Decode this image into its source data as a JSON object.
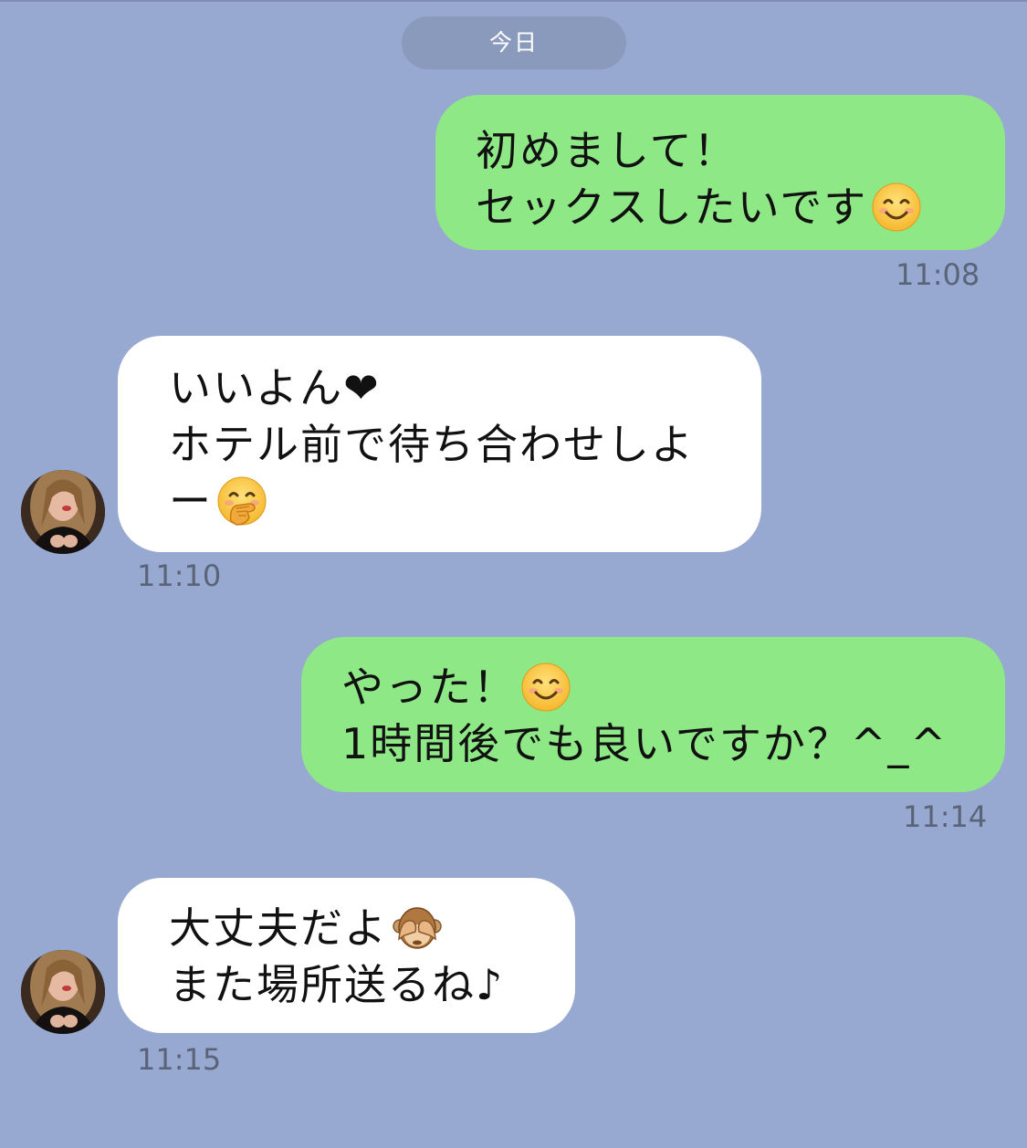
{
  "header": {
    "date_label": "今日"
  },
  "messages": [
    {
      "direction": "out",
      "lines": [
        "初めまして！",
        "セックスしたいです"
      ],
      "emoji": "smiling-face-icon",
      "time": "11:08"
    },
    {
      "direction": "in",
      "lines": [
        "いいよん❤",
        "ホテル前で待ち合わせしよ",
        "ー"
      ],
      "emoji": "face-with-hand-over-mouth-icon",
      "time": "11:10"
    },
    {
      "direction": "out",
      "lines": [
        "やった！",
        "1時間後でも良いですか？^_^"
      ],
      "emoji": "smiling-face-icon",
      "time": "11:14"
    },
    {
      "direction": "in",
      "lines": [
        "大丈夫だよ",
        "また場所送るね♪"
      ],
      "emoji": "see-no-evil-monkey-icon",
      "time": "11:15"
    }
  ],
  "colors": {
    "background": "#97a9d0",
    "outgoing_bubble": "#8ee886",
    "incoming_bubble": "#ffffff",
    "date_pill": "#8a9abc",
    "timestamp": "#5a6478"
  }
}
